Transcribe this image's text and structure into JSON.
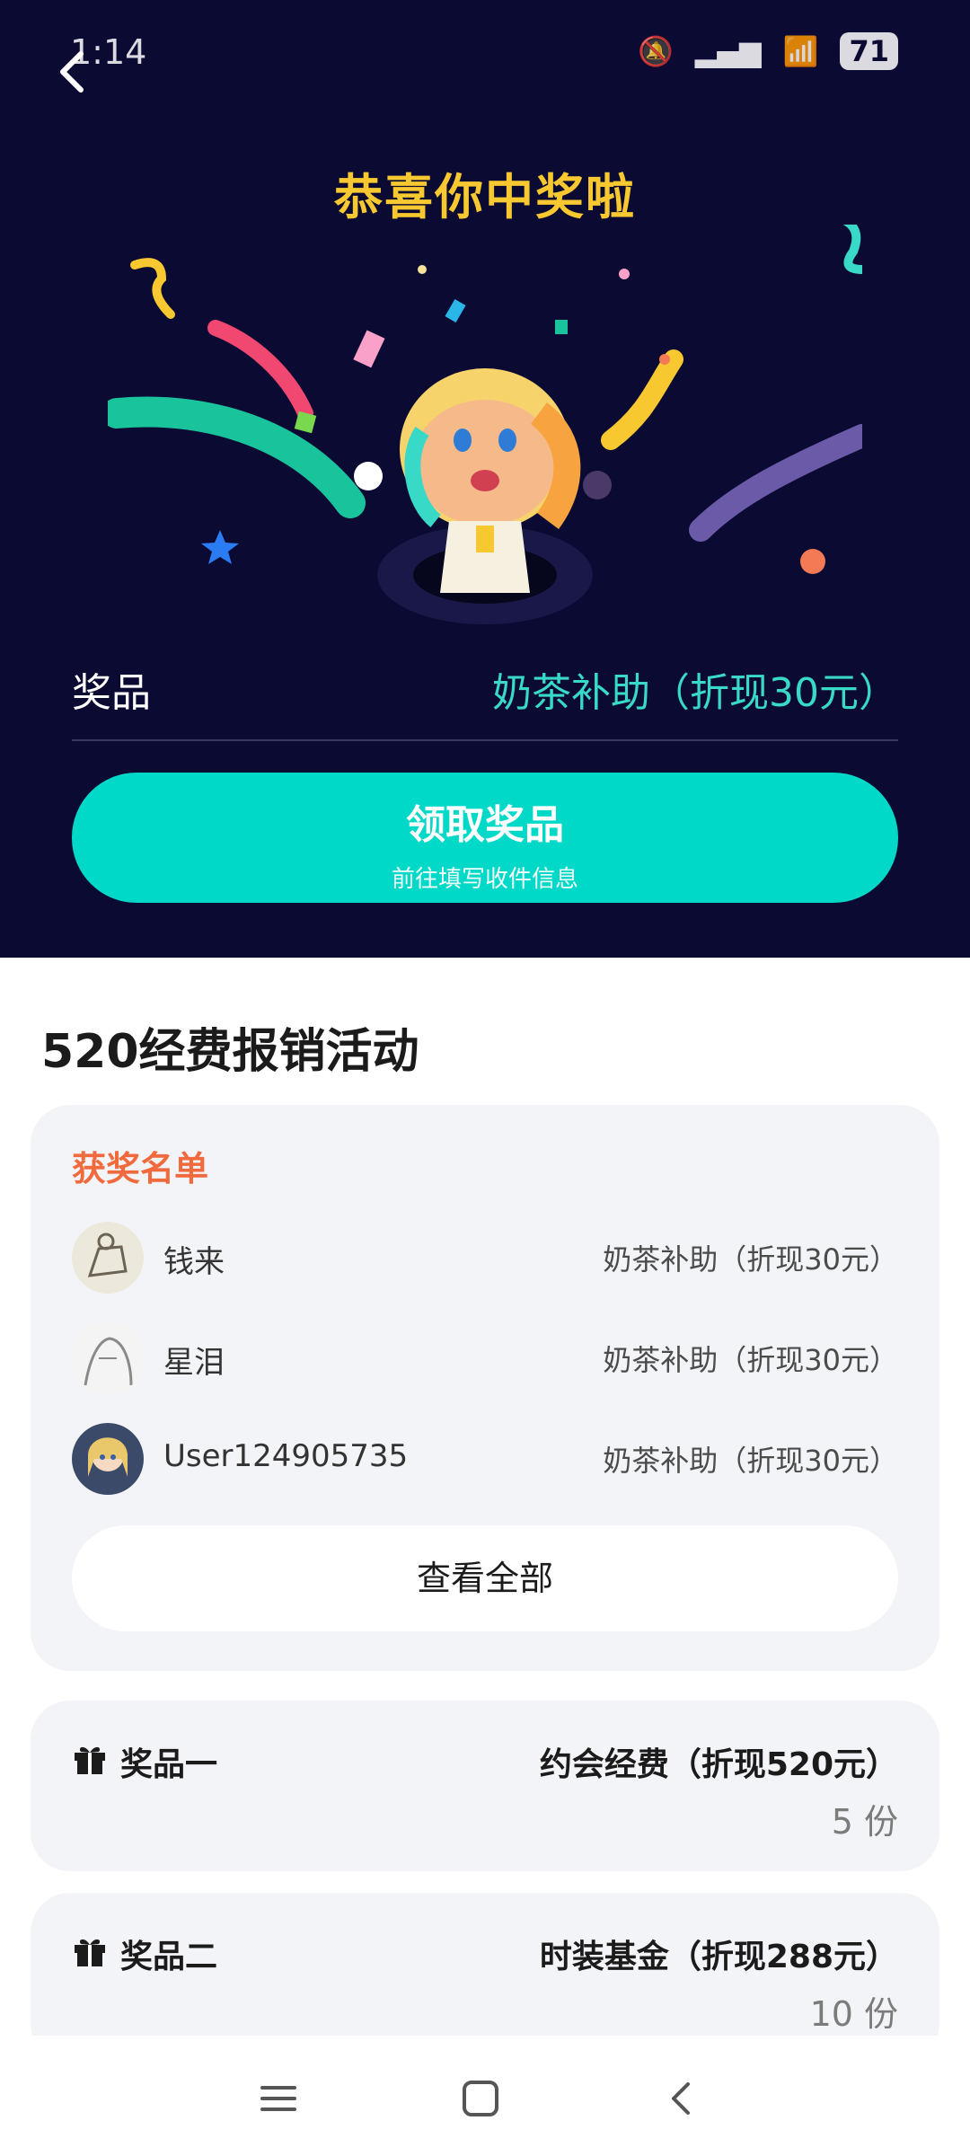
{
  "status": {
    "time": "1:14",
    "battery": "71",
    "icons": [
      "mute-icon",
      "signal-5g-icon",
      "wifi-icon",
      "battery-icon"
    ]
  },
  "hero": {
    "title": "恭喜你中奖啦",
    "prize_label": "奖品",
    "prize_value": "奶茶补助（折现30元）",
    "claim_button": {
      "label": "领取奖品",
      "sub": "前往填写收件信息"
    }
  },
  "activity": {
    "title": "520经费报销活动"
  },
  "winners": {
    "title": "获奖名单",
    "rows": [
      {
        "name": "钱来",
        "prize": "奶茶补助（折现30元）"
      },
      {
        "name": "星泪",
        "prize": "奶茶补助（折现30元）"
      },
      {
        "name": "User124905735",
        "prize": "奶茶补助（折现30元）"
      }
    ],
    "view_all": "查看全部"
  },
  "prizes": [
    {
      "title": "奖品一",
      "name": "约会经费（折现520元）",
      "count": "5 份"
    },
    {
      "title": "奖品二",
      "name": "时装基金（折现288元）",
      "count": "10 份"
    }
  ],
  "colors": {
    "hero_bg": "#0b0a33",
    "accent": "#00d8c8",
    "title_yellow": "#f8c830",
    "winners_orange": "#f06a3d"
  }
}
